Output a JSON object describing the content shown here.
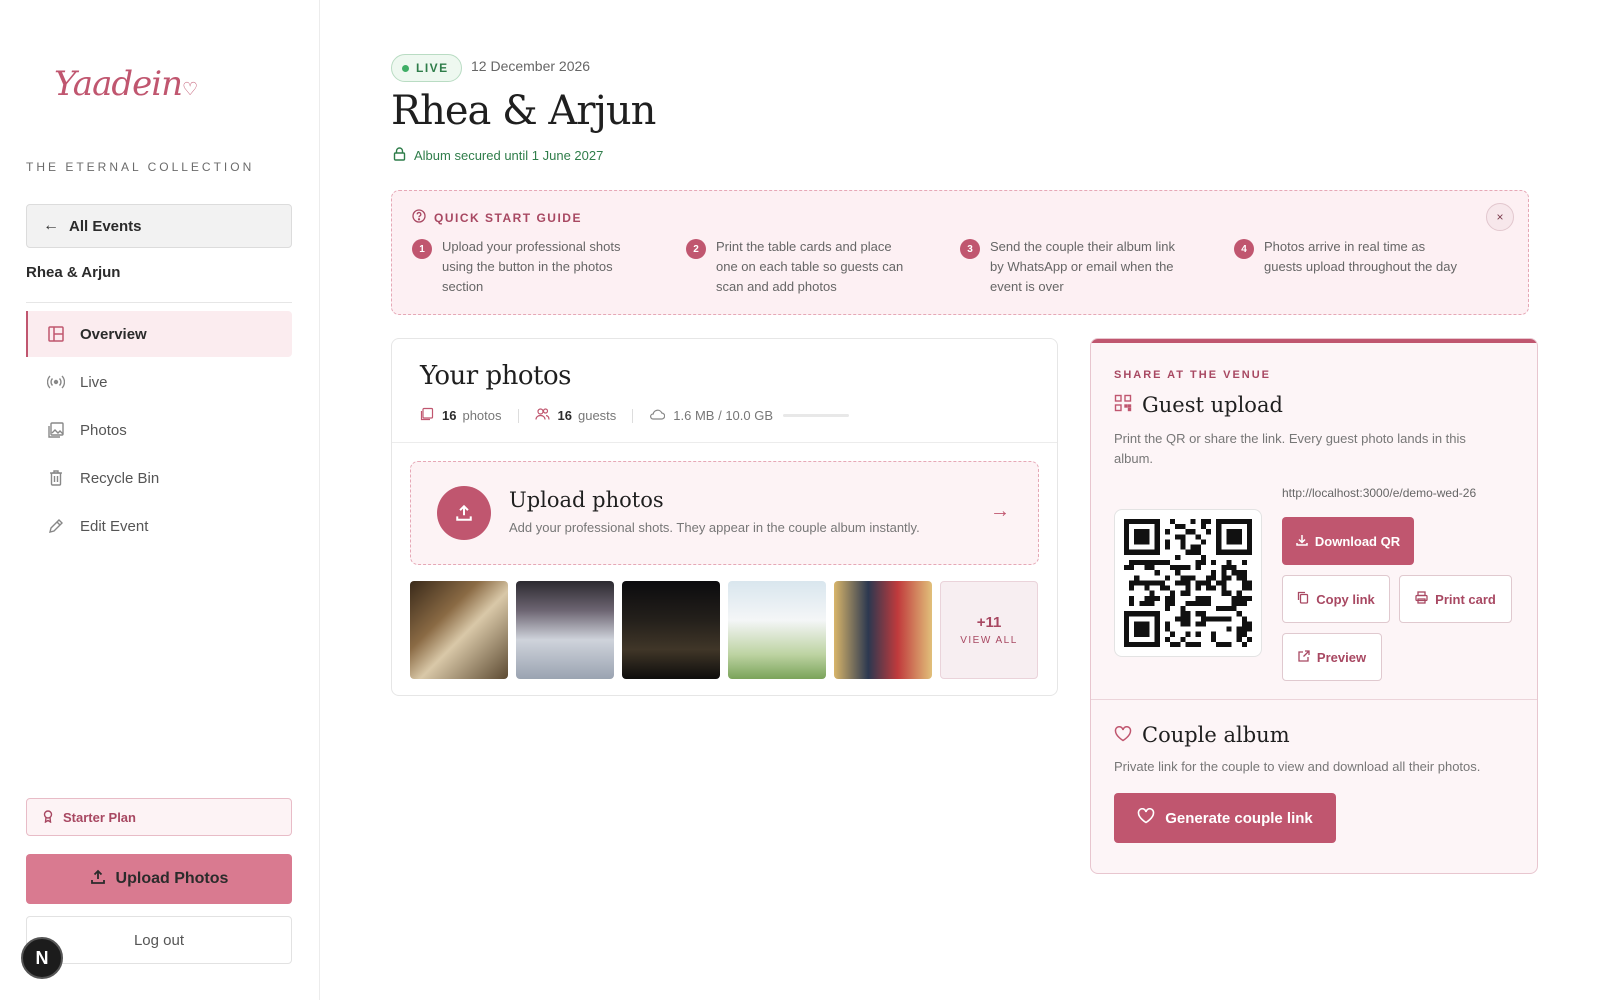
{
  "sidebar": {
    "logo": "Yaadein",
    "collection": "THE ETERNAL COLLECTION",
    "all_events": "All Events",
    "event_name": "Rhea & Arjun",
    "nav": [
      {
        "label": "Overview",
        "icon": "layout-icon"
      },
      {
        "label": "Live",
        "icon": "broadcast-icon"
      },
      {
        "label": "Photos",
        "icon": "photos-icon"
      },
      {
        "label": "Recycle Bin",
        "icon": "trash-icon"
      },
      {
        "label": "Edit Event",
        "icon": "pencil-icon"
      }
    ],
    "plan": "Starter Plan",
    "upload": "Upload Photos",
    "logout": "Log out",
    "badge": "N"
  },
  "header": {
    "status": "LIVE",
    "date": "12 December 2026",
    "title": "Rhea & Arjun",
    "secured": "Album secured until 1 June 2027"
  },
  "guide": {
    "title": "QUICK START GUIDE",
    "close": "×",
    "steps": [
      {
        "num": "1",
        "text": "Upload your professional shots using the button in the photos section"
      },
      {
        "num": "2",
        "text": "Print the table cards and place one on each table so guests can scan and add photos"
      },
      {
        "num": "3",
        "text": "Send the couple their album link by WhatsApp or email when the event is over"
      },
      {
        "num": "4",
        "text": "Photos arrive in real time as guests upload throughout the day"
      }
    ]
  },
  "photos": {
    "title": "Your photos",
    "photo_count": "16",
    "photo_label": "photos",
    "guest_count": "16",
    "guest_label": "guests",
    "storage": "1.6 MB / 10.0 GB",
    "storage_fraction": 0.02,
    "upload_title": "Upload photos",
    "upload_sub": "Add your professional shots. They appear in the couple album instantly.",
    "more_count": "+11",
    "view_all": "VIEW ALL"
  },
  "share": {
    "label": "SHARE AT THE VENUE",
    "guest_title": "Guest upload",
    "guest_desc": "Print the QR or share the link. Every guest photo lands in this album.",
    "url": "http://localhost:3000/e/demo-wed-26",
    "download_qr": "Download QR",
    "copy_link": "Copy link",
    "print_card": "Print card",
    "preview": "Preview",
    "couple_title": "Couple album",
    "couple_desc": "Private link for the couple to view and download all their photos.",
    "generate": "Generate couple link"
  },
  "colors": {
    "accent": "#c0566f",
    "live": "#2f7d4a"
  }
}
